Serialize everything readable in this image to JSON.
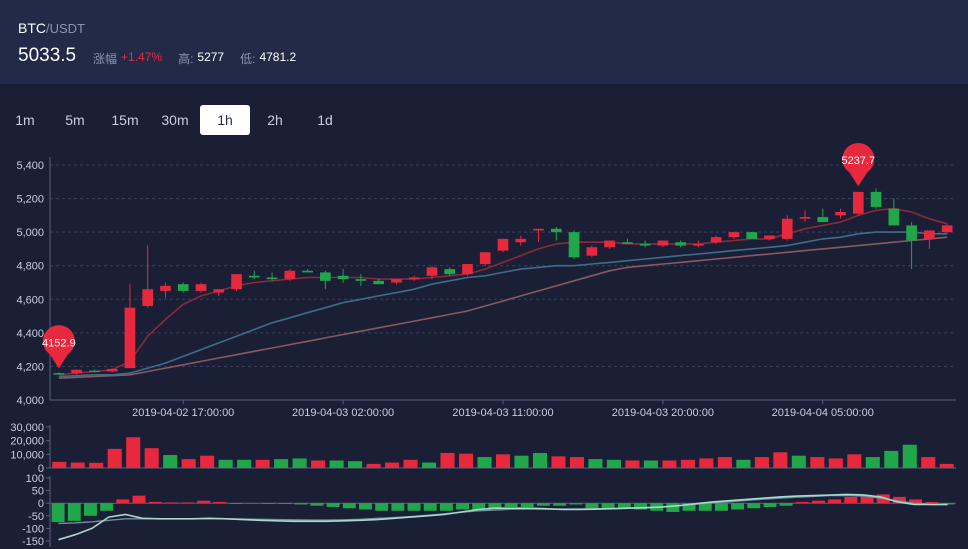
{
  "ticker": {
    "base": "BTC",
    "quote": "/USDT",
    "last_price": "5033.5",
    "change_label": "涨幅",
    "change_value": "+1.47%",
    "high_label": "高:",
    "high_value": "5277",
    "low_label": "低:",
    "low_value": "4781.2"
  },
  "intervals": [
    "1m",
    "5m",
    "15m",
    "30m",
    "1h",
    "2h",
    "1d"
  ],
  "active_interval": "1h",
  "colors": {
    "up": "#e8293d",
    "down": "#1fa74a",
    "ma_short": "#8a2a3a",
    "ma_mid": "#3e6d8c",
    "ma_long": "#8a5860",
    "macd_line": "#a8d8c8",
    "signal_line": "#6f8fa0"
  },
  "chart_data": [
    {
      "type": "candlestick",
      "ylim": [
        4000,
        5400
      ],
      "y_ticks": [
        "4,000",
        "4,200",
        "4,400",
        "4,600",
        "4,800",
        "5,000",
        "5,200",
        "5,400"
      ],
      "x_tick_labels": [
        "2019-04-02 17:00:00",
        "2019-04-03 02:00:00",
        "2019-04-03 11:00:00",
        "2019-04-03 20:00:00",
        "2019-04-04 05:00:00"
      ],
      "markers": [
        {
          "label": "4152.9",
          "value": 4152.9,
          "index": 0
        },
        {
          "label": "5237.7",
          "value": 5237.7,
          "index": 45
        }
      ],
      "candles": [
        [
          4160,
          4165,
          4150,
          4158
        ],
        [
          4160,
          4182,
          4150,
          4180
        ],
        [
          4175,
          4182,
          4168,
          4170
        ],
        [
          4170,
          4190,
          4165,
          4185
        ],
        [
          4190,
          4690,
          4190,
          4550
        ],
        [
          4560,
          4920,
          4550,
          4660
        ],
        [
          4650,
          4700,
          4610,
          4680
        ],
        [
          4690,
          4700,
          4640,
          4650
        ],
        [
          4650,
          4700,
          4640,
          4690
        ],
        [
          4640,
          4660,
          4620,
          4660
        ],
        [
          4660,
          4740,
          4650,
          4750
        ],
        [
          4740,
          4770,
          4720,
          4730
        ],
        [
          4730,
          4760,
          4710,
          4720
        ],
        [
          4720,
          4780,
          4710,
          4770
        ],
        [
          4770,
          4780,
          4760,
          4760
        ],
        [
          4760,
          4770,
          4660,
          4710
        ],
        [
          4740,
          4780,
          4700,
          4720
        ],
        [
          4720,
          4750,
          4680,
          4710
        ],
        [
          4710,
          4720,
          4690,
          4690
        ],
        [
          4700,
          4720,
          4690,
          4720
        ],
        [
          4720,
          4740,
          4710,
          4730
        ],
        [
          4740,
          4800,
          4720,
          4790
        ],
        [
          4780,
          4790,
          4740,
          4750
        ],
        [
          4750,
          4810,
          4740,
          4810
        ],
        [
          4810,
          4880,
          4800,
          4880
        ],
        [
          4890,
          4950,
          4880,
          4960
        ],
        [
          4940,
          4980,
          4920,
          4960
        ],
        [
          5010,
          5020,
          4940,
          5020
        ],
        [
          5020,
          5030,
          4950,
          5000
        ],
        [
          5000,
          5010,
          4840,
          4850
        ],
        [
          4860,
          4920,
          4850,
          4910
        ],
        [
          4910,
          4940,
          4900,
          4950
        ],
        [
          4940,
          4960,
          4930,
          4930
        ],
        [
          4930,
          4950,
          4910,
          4920
        ],
        [
          4920,
          4940,
          4910,
          4950
        ],
        [
          4940,
          4950,
          4910,
          4920
        ],
        [
          4920,
          4950,
          4910,
          4930
        ],
        [
          4940,
          4980,
          4930,
          4970
        ],
        [
          4970,
          5000,
          4960,
          5000
        ],
        [
          5000,
          5000,
          4960,
          4960
        ],
        [
          4960,
          4980,
          4950,
          4980
        ],
        [
          4960,
          5100,
          4950,
          5080
        ],
        [
          5080,
          5130,
          5060,
          5090
        ],
        [
          5090,
          5140,
          5060,
          5060
        ],
        [
          5100,
          5140,
          5080,
          5120
        ],
        [
          5110,
          5240,
          5100,
          5240
        ],
        [
          5240,
          5260,
          5140,
          5150
        ],
        [
          5140,
          5200,
          5040,
          5040
        ],
        [
          5040,
          5060,
          4780,
          4950
        ],
        [
          4960,
          5010,
          4900,
          5010
        ],
        [
          5000,
          5050,
          4990,
          5040
        ]
      ],
      "ma_short": [
        4150,
        4160,
        4170,
        4180,
        4230,
        4380,
        4480,
        4570,
        4620,
        4650,
        4680,
        4700,
        4710,
        4720,
        4730,
        4730,
        4730,
        4730,
        4720,
        4720,
        4720,
        4730,
        4740,
        4750,
        4780,
        4820,
        4860,
        4900,
        4930,
        4940,
        4940,
        4940,
        4930,
        4930,
        4930,
        4930,
        4930,
        4940,
        4950,
        4960,
        4960,
        4990,
        5020,
        5040,
        5060,
        5100,
        5130,
        5140,
        5120,
        5080,
        5050
      ],
      "ma_mid": [
        4140,
        4145,
        4150,
        4150,
        4160,
        4190,
        4220,
        4260,
        4300,
        4340,
        4380,
        4420,
        4460,
        4490,
        4520,
        4550,
        4580,
        4600,
        4620,
        4640,
        4660,
        4690,
        4710,
        4730,
        4740,
        4760,
        4780,
        4790,
        4800,
        4800,
        4810,
        4820,
        4830,
        4840,
        4850,
        4860,
        4870,
        4880,
        4890,
        4900,
        4910,
        4920,
        4940,
        4960,
        4970,
        4990,
        5000,
        5000,
        5000,
        4990,
        4990
      ],
      "ma_long": [
        4130,
        4135,
        4140,
        4145,
        4150,
        4170,
        4190,
        4210,
        4230,
        4250,
        4270,
        4290,
        4310,
        4330,
        4350,
        4370,
        4390,
        4410,
        4430,
        4450,
        4470,
        4490,
        4510,
        4530,
        4560,
        4590,
        4620,
        4650,
        4680,
        4710,
        4740,
        4770,
        4790,
        4800,
        4810,
        4820,
        4830,
        4840,
        4850,
        4860,
        4870,
        4880,
        4890,
        4900,
        4910,
        4920,
        4930,
        4940,
        4950,
        4960,
        4970
      ]
    },
    {
      "type": "bar",
      "ylim": [
        0,
        30000
      ],
      "y_ticks": [
        "0",
        "10,000",
        "20,000",
        "30,000"
      ],
      "values": [
        4500,
        4000,
        3800,
        14000,
        22500,
        14500,
        9500,
        6500,
        9000,
        6000,
        6000,
        6000,
        6500,
        7000,
        5500,
        5500,
        5000,
        3000,
        4000,
        6000,
        4000,
        11000,
        10500,
        8000,
        10000,
        9000,
        11000,
        8500,
        8000,
        6500,
        6000,
        5500,
        5500,
        5500,
        6000,
        7000,
        8000,
        6000,
        8000,
        11500,
        9000,
        8000,
        7000,
        10000,
        8000,
        12500,
        17000,
        8000,
        3000
      ],
      "up": [
        1,
        1,
        1,
        1,
        1,
        1,
        0,
        1,
        1,
        0,
        0,
        1,
        0,
        0,
        1,
        0,
        0,
        1,
        1,
        1,
        0,
        1,
        1,
        0,
        1,
        0,
        0,
        1,
        1,
        0,
        0,
        1,
        0,
        1,
        1,
        1,
        1,
        0,
        1,
        1,
        0,
        1,
        1,
        1,
        0,
        0,
        0,
        1,
        1
      ]
    },
    {
      "type": "macd",
      "ylim": [
        -150,
        100
      ],
      "y_ticks": [
        "100",
        "50",
        "0",
        "-50",
        "-100",
        "-150"
      ],
      "hist": [
        -75,
        -70,
        -50,
        -30,
        15,
        30,
        5,
        3,
        3,
        10,
        5,
        -3,
        -2,
        -3,
        -3,
        -5,
        -10,
        -15,
        -20,
        -25,
        -30,
        -30,
        -30,
        -30,
        -30,
        -25,
        -25,
        -20,
        -15,
        -15,
        -10,
        -10,
        -5,
        -20,
        -25,
        -20,
        -25,
        -30,
        -35,
        -30,
        -30,
        -30,
        -25,
        -20,
        -15,
        -10,
        5,
        10,
        15,
        25,
        30,
        35,
        25,
        15,
        5,
        -5
      ],
      "macd": [
        -145,
        -125,
        -100,
        -55,
        -45,
        -60,
        -62,
        -62,
        -62,
        -60,
        -62,
        -65,
        -68,
        -70,
        -72,
        -72,
        -72,
        -70,
        -68,
        -65,
        -60,
        -55,
        -50,
        -45,
        -35,
        -25,
        -20,
        -20,
        -20,
        -22,
        -25,
        -25,
        -24,
        -22,
        -20,
        -18,
        -15,
        -10,
        -2,
        5,
        10,
        15,
        20,
        25,
        28,
        30,
        32,
        35,
        33,
        25,
        5,
        -5,
        -5,
        -5
      ],
      "signal": [
        -80,
        -78,
        -74,
        -68,
        -62,
        -62,
        -62,
        -62,
        -62,
        -62,
        -62,
        -63,
        -64,
        -65,
        -66,
        -67,
        -67,
        -66,
        -64,
        -60,
        -57,
        -53,
        -48,
        -42,
        -36,
        -30,
        -27,
        -24,
        -23,
        -23,
        -23,
        -23,
        -22,
        -21,
        -20,
        -18,
        -14,
        -9,
        -4,
        1,
        6,
        11,
        16,
        20,
        24,
        27,
        30,
        31,
        28,
        20,
        10,
        0,
        -5,
        -6
      ]
    }
  ]
}
